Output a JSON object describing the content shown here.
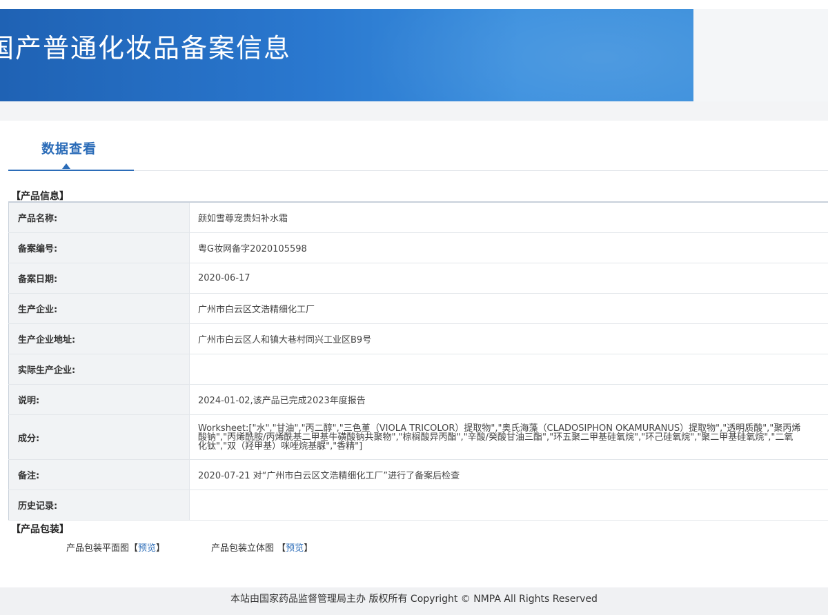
{
  "header": {
    "title": "国产普通化妆品备案信息"
  },
  "tabs": [
    {
      "label": "数据查看"
    }
  ],
  "product_info": {
    "section_title": "【产品信息】",
    "rows": [
      {
        "label": "产品名称:",
        "value": "颜如雪尊宠贵妇补水霜"
      },
      {
        "label": "备案编号:",
        "value": "粤G妆网备字2020105598"
      },
      {
        "label": "备案日期:",
        "value": "2020-06-17"
      },
      {
        "label": "生产企业:",
        "value": "广州市白云区文浩精细化工厂"
      },
      {
        "label": "生产企业地址:",
        "value": "广州市白云区人和镇大巷村同兴工业区B9号"
      },
      {
        "label": "实际生产企业:",
        "value": ""
      },
      {
        "label": "说明:",
        "value": "2024-01-02,该产品已完成2023年度报告"
      },
      {
        "label": "成分:",
        "value": "Worksheet:[\"水\",\"甘油\",\"丙二醇\",\"三色堇（VIOLA TRICOLOR）提取物\",\"奥氏海藻（CLADOSIPHON OKAMURANUS）提取物\",\"透明质酸\",\"聚丙烯酸钠\",\"丙烯酰胺/丙烯酰基二甲基牛磺酸钠共聚物\",\"棕榈酸异丙酯\",\"辛酸/癸酸甘油三酯\",\"环五聚二甲基硅氧烷\",\"环己硅氧烷\",\"聚二甲基硅氧烷\",\"二氧化钛\",\"双（羟甲基）咪唑烷基脲\",\"香精\"]"
      },
      {
        "label": "备注:",
        "value": "2020-07-21 对“广州市白云区文浩精细化工厂”进行了备案后检查"
      },
      {
        "label": "历史记录:",
        "value": ""
      }
    ]
  },
  "packaging": {
    "section_title": "【产品包装】",
    "items": [
      {
        "label": "产品包装平面图",
        "bracket_open": "【",
        "link": "预览",
        "bracket_close": "】"
      },
      {
        "label": "产品包装立体图",
        "bracket_open": "【",
        "link": "预览",
        "bracket_close": "】"
      }
    ]
  },
  "footer": {
    "text": "本站由国家药品监督管理局主办 版权所有 Copyright © NMPA All Rights Reserved"
  }
}
